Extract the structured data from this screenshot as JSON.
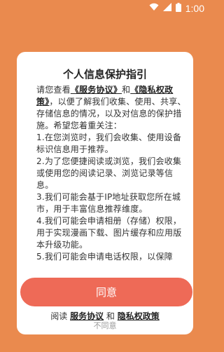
{
  "status_bar": {
    "time": "1:00",
    "icons": [
      "wifi-icon",
      "signal-icon",
      "battery-icon"
    ]
  },
  "dialog": {
    "title": "个人信息保护指引",
    "intro_prefix": "请您查看",
    "link_service": "《服务协议》",
    "and1": "和",
    "link_privacy": "《隐私权政策》",
    "intro_suffix": "，以便了解我们收集、使用、共享、存储信息的情况，以及对信息的保护措施。希望您着重关注：",
    "items": [
      "1.在您浏览时，我们会收集、使用设备标识信息用于推荐。",
      "2.为了您便捷阅读或浏览，我们会收集或使用您的阅读记录、浏览记录等信息。",
      "3.我们可能会基于IP地址获取您所在城市，用于丰富信息推荐维度。",
      "4.我们可能会申请相册（存储）权限，用于实现漫画下载、图片缓存和应用版本升级功能。",
      "5.我们可能会申请电话权限，以保障"
    ],
    "bottom_prefix": "阅读",
    "bottom_link_service": "服务协议",
    "bottom_and": "和",
    "bottom_link_privacy": "隐私权政策",
    "agree_label": "同意",
    "disagree_label": "不同意"
  },
  "colors": {
    "background": "#ea8a4e",
    "agree_button": "#ee6a57"
  }
}
